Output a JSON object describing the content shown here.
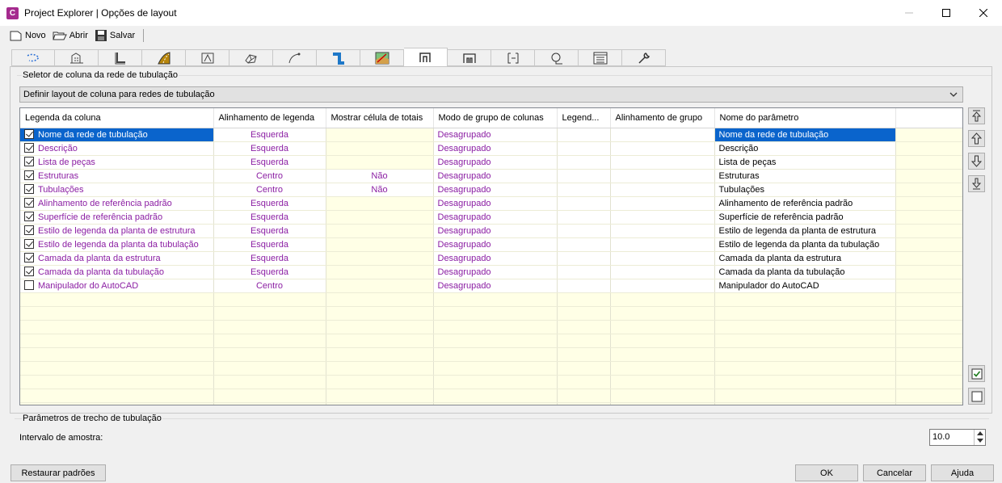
{
  "window": {
    "title": "Project Explorer | Opções de layout",
    "app_icon_letter": "C"
  },
  "toolbar": {
    "novo": "Novo",
    "abrir": "Abrir",
    "salvar": "Salvar"
  },
  "tabs": {
    "count": 15,
    "active_index": 9,
    "icons": [
      "dashed-arc-icon",
      "building-icon",
      "pipe-bend-icon",
      "road-icon",
      "alignment-icon",
      "surface-icon",
      "curve-icon",
      "pipe-network-icon",
      "map-icon",
      "pipe-network-columns-icon",
      "structure-icon",
      "profile-icon",
      "pipe-icon",
      "list-icon",
      "wrench-icon"
    ]
  },
  "selector": {
    "group_label": "Seletor de coluna da rede de tubulação",
    "dropdown_value": "Definir layout de coluna para redes de tubulação"
  },
  "grid": {
    "headers": [
      "Legenda da coluna",
      "Alinhamento de legenda",
      "Mostrar célula de totais",
      "Modo de grupo de colunas",
      "Legend...",
      "Alinhamento de grupo",
      "Nome do parâmetro",
      ""
    ],
    "rows": [
      {
        "checked": true,
        "legend": "Nome da rede de tubulação",
        "align": "Esquerda",
        "totals": "",
        "mode": "Desagrupado",
        "param": "Nome da rede de tubulação",
        "selected": true
      },
      {
        "checked": true,
        "legend": "Descrição",
        "align": "Esquerda",
        "totals": "",
        "mode": "Desagrupado",
        "param": "Descrição"
      },
      {
        "checked": true,
        "legend": "Lista de peças",
        "align": "Esquerda",
        "totals": "",
        "mode": "Desagrupado",
        "param": "Lista de peças"
      },
      {
        "checked": true,
        "legend": "Estruturas",
        "align": "Centro",
        "totals": "Não",
        "mode": "Desagrupado",
        "param": "Estruturas"
      },
      {
        "checked": true,
        "legend": "Tubulações",
        "align": "Centro",
        "totals": "Não",
        "mode": "Desagrupado",
        "param": "Tubulações"
      },
      {
        "checked": true,
        "legend": "Alinhamento de referência padrão",
        "align": "Esquerda",
        "totals": "",
        "mode": "Desagrupado",
        "param": "Alinhamento de referência padrão"
      },
      {
        "checked": true,
        "legend": "Superfície de referência padrão",
        "align": "Esquerda",
        "totals": "",
        "mode": "Desagrupado",
        "param": "Superfície de referência padrão"
      },
      {
        "checked": true,
        "legend": "Estilo de legenda da planta de estrutura",
        "align": "Esquerda",
        "totals": "",
        "mode": "Desagrupado",
        "param": "Estilo de legenda da planta de estrutura"
      },
      {
        "checked": true,
        "legend": "Estilo de legenda da planta da tubulação",
        "align": "Esquerda",
        "totals": "",
        "mode": "Desagrupado",
        "param": "Estilo de legenda da planta da tubulação"
      },
      {
        "checked": true,
        "legend": "Camada da planta da estrutura",
        "align": "Esquerda",
        "totals": "",
        "mode": "Desagrupado",
        "param": "Camada da planta da estrutura"
      },
      {
        "checked": true,
        "legend": "Camada da planta da tubulação",
        "align": "Esquerda",
        "totals": "",
        "mode": "Desagrupado",
        "param": "Camada da planta da tubulação"
      },
      {
        "checked": false,
        "legend": "Manipulador do AutoCAD",
        "align": "Centro",
        "totals": "",
        "mode": "Desagrupado",
        "param": "Manipulador do AutoCAD"
      }
    ],
    "empty_rows": 9
  },
  "params": {
    "group_label": "Parâmetros de trecho de tubulação",
    "intervalo_label": "Intervalo de amostra:",
    "intervalo_value": "10.0"
  },
  "footer": {
    "restore": "Restaurar padrões",
    "ok": "OK",
    "cancel": "Cancelar",
    "help": "Ajuda"
  },
  "colors": {
    "purple_text": "#8b1ea3",
    "selection": "#0a64cc",
    "grid_bg": "#ffffe6"
  }
}
